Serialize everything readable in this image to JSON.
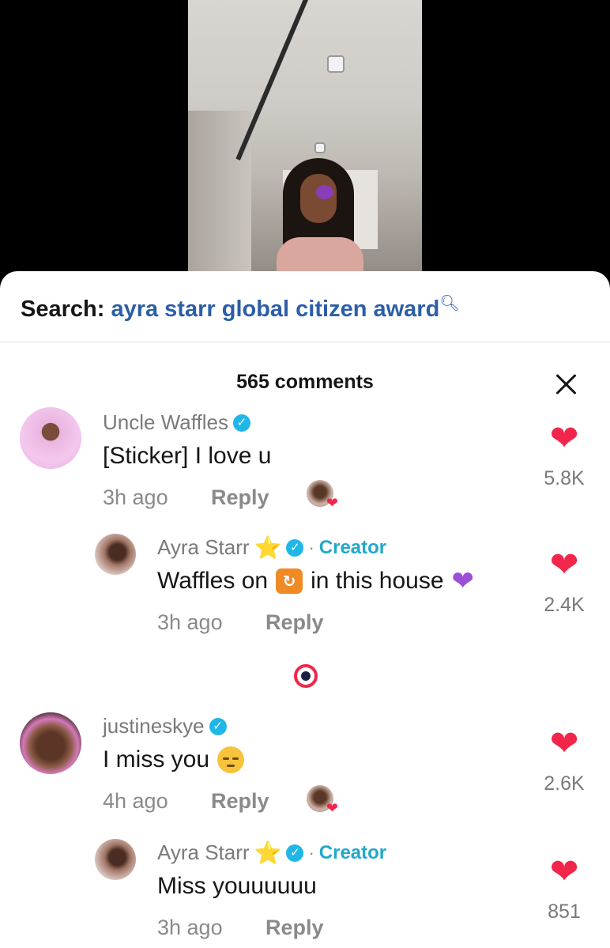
{
  "search": {
    "label": "Search:",
    "term": "ayra starr global citizen award"
  },
  "comments": {
    "count_label": "565 comments",
    "items": [
      {
        "username": "Uncle Waffles",
        "text": "[Sticker] I love u",
        "time": "3h ago",
        "reply_label": "Reply",
        "likes": "5.8K",
        "verified": true,
        "creator_liked": true
      },
      {
        "username": "Ayra Starr",
        "badge_label": "Creator",
        "text_before": "Waffles on",
        "emoji_icon": "repeat-one-emoji",
        "text_after": "in this house",
        "time": "3h ago",
        "reply_label": "Reply",
        "likes": "2.4K",
        "verified": true
      },
      {
        "username": "justineskye",
        "text": "I miss you",
        "emoji_icon": "pensive-face-emoji",
        "time": "4h ago",
        "reply_label": "Reply",
        "likes": "2.6K",
        "verified": true,
        "creator_liked": true
      },
      {
        "username": "Ayra Starr",
        "badge_label": "Creator",
        "text": "Miss youuuuuu",
        "time": "3h ago",
        "reply_label": "Reply",
        "likes": "851",
        "verified": true
      }
    ]
  },
  "colors": {
    "accent_heart": "#f2264b",
    "search_term": "#2c5ea8",
    "creator": "#22a8c9",
    "verified": "#20b7e8"
  }
}
